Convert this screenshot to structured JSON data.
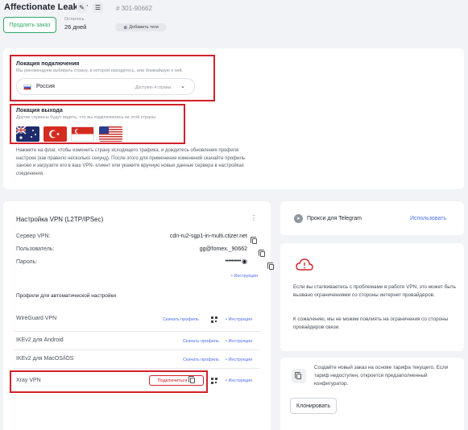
{
  "header": {
    "title": "Affectionate Leakey",
    "order_id": "# 301-90662",
    "extend_button": "Продлить заказ",
    "remaining_label": "Осталось",
    "remaining_value": "26 дней",
    "add_tags": "Добавить теги"
  },
  "connection_location": {
    "title": "Локация подключения",
    "hint": "Мы рекомендуем выбирать страну, в которой находитесь, или ближайшую к ней.",
    "selected_country": "Россия",
    "available": "Доступно 4 страны"
  },
  "exit_location": {
    "title": "Локация выхода",
    "hint": "Другие сервисы будут видеть, что вы подключились из этой страны.",
    "flags": [
      "Australia",
      "Turkey",
      "Singapore",
      "USA"
    ],
    "note": "Нажмите на флаг, чтобы изменить страну исходящего трафика, и дождитесь обновления профиля настроек (как правило несколько секунд). После этого для применения изменений скачайте профиль заново и загрузите его в ваш VPN- клиент или укажите вручную новые данные сервера в настройках соединения."
  },
  "vpn": {
    "title": "Настройка VPN (L2TP/IPSec)",
    "server_label": "Сервер VPN:",
    "server_value": "cdn-ru2-sgp1-in-multi.ctizer.net",
    "user_label": "Пользователь:",
    "user_value": "gg@fomex._90662",
    "password_label": "Пароль:",
    "password_value": "••••••••••",
    "instructions": "• Инструкция",
    "profiles_title": "Профили для автоматической настройки",
    "profiles": [
      {
        "name": "WireGuard VPN",
        "action": "Скачать профиль",
        "instr": "• Инструкция"
      },
      {
        "name": "IKEv2 для Android",
        "action": "Скачать профиль",
        "instr": "• Инструкция"
      },
      {
        "name": "IKEv2 для MacOS/iOS",
        "action": "Скачать профиль",
        "instr": "• Инструкция"
      },
      {
        "name": "Xray VPN",
        "action": "Подключиться",
        "instr": "• Инструкция"
      }
    ]
  },
  "telegram": {
    "label": "Прокси для Telegram",
    "action": "Использовать"
  },
  "warning": {
    "text1": "Если вы сталкиваетесь с проблемами в работе VPN, это может быть вызвано ограничениями со стороны интернет провайдеров.",
    "text2": "К сожалению, мы не можем повлиять на ограничения со стороны провайдеров связи."
  },
  "clone": {
    "text": "Создайте новый заказ на основе тарифа текущего. Если тариф недоступен, откроется предзаполненный конфигуратор.",
    "button": "Клонировать"
  },
  "colors": {
    "accent": "#4d6ff0",
    "success": "#2fa866",
    "highlight": "#d3202a"
  }
}
